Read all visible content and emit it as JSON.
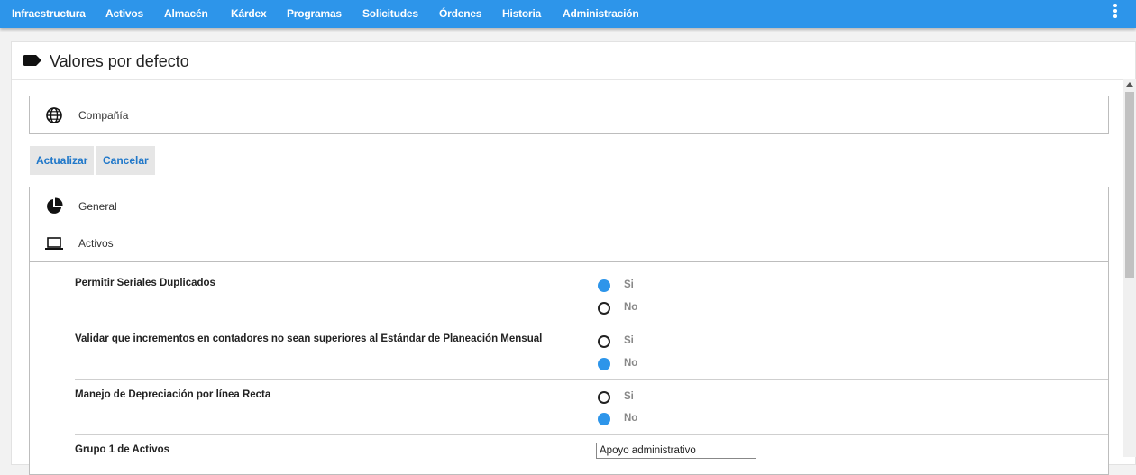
{
  "nav": {
    "items": [
      {
        "label": "Infraestructura"
      },
      {
        "label": "Activos"
      },
      {
        "label": "Almacén"
      },
      {
        "label": "Kárdex"
      },
      {
        "label": "Programas"
      },
      {
        "label": "Solicitudes"
      },
      {
        "label": "Órdenes"
      },
      {
        "label": "Historia"
      },
      {
        "label": "Administración"
      }
    ]
  },
  "page": {
    "title": "Valores por defecto",
    "title_icon": "tag-icon"
  },
  "company_panel": {
    "label": "Compañía",
    "icon": "globe-icon"
  },
  "actions": {
    "update_label": "Actualizar",
    "cancel_label": "Cancelar"
  },
  "sections": {
    "general": {
      "label": "General",
      "icon": "pie-chart-icon"
    },
    "activos": {
      "label": "Activos",
      "icon": "laptop-icon"
    }
  },
  "settings": [
    {
      "label": "Permitir Seriales Duplicados",
      "options": [
        "Si",
        "No"
      ],
      "selected": "Si"
    },
    {
      "label": "Validar que incrementos en contadores no sean superiores al Estándar de Planeación Mensual",
      "options": [
        "Si",
        "No"
      ],
      "selected": "No"
    },
    {
      "label": "Manejo de Depreciación por línea Recta",
      "options": [
        "Si",
        "No"
      ],
      "selected": "No"
    },
    {
      "label": "Grupo 1 de Activos",
      "value": "Apoyo administrativo"
    }
  ],
  "colors": {
    "topbar": "#2d95ea",
    "radio_selected": "#2d95ea",
    "button_text": "#1f77c9"
  }
}
